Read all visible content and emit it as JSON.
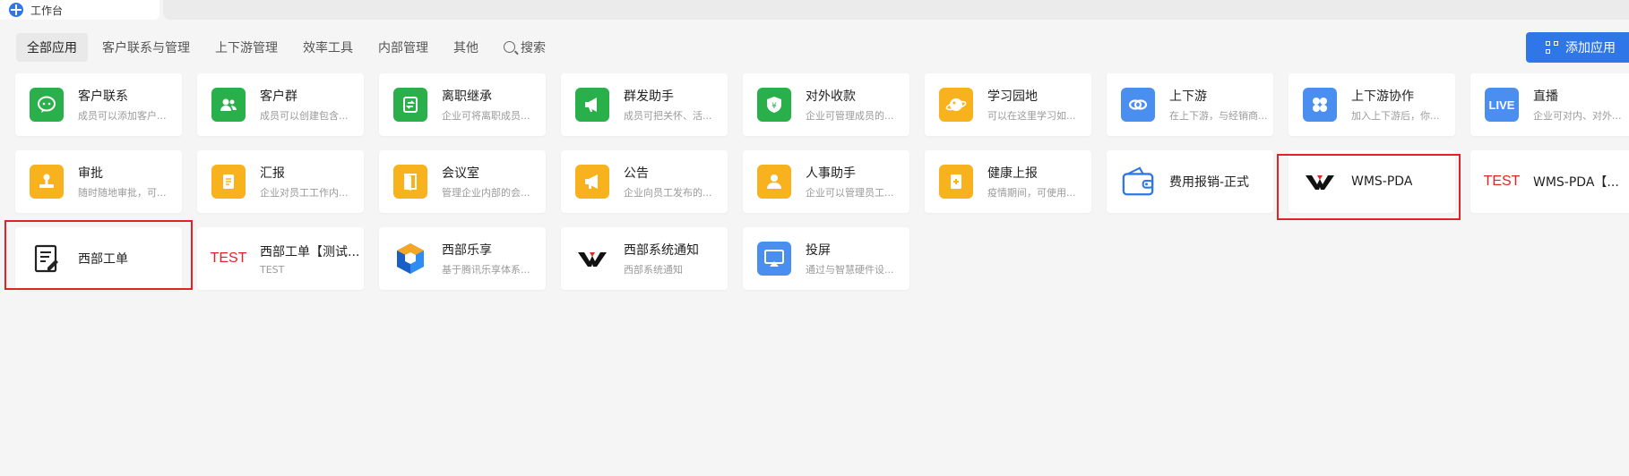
{
  "tab": {
    "title": "工作台"
  },
  "filters": [
    {
      "label": "全部应用"
    },
    {
      "label": "客户联系与管理"
    },
    {
      "label": "上下游管理"
    },
    {
      "label": "效率工具"
    },
    {
      "label": "内部管理"
    },
    {
      "label": "其他"
    },
    {
      "label": "搜索"
    }
  ],
  "add_button": {
    "label": "添加应用"
  },
  "apps": [
    {
      "name": "客户联系",
      "desc": "成员可以添加客户...",
      "icon": "chat-icon",
      "color": "#2ab04a"
    },
    {
      "name": "客户群",
      "desc": "成员可以创建包含...",
      "icon": "group-icon",
      "color": "#2ab04a"
    },
    {
      "name": "离职继承",
      "desc": "企业可将离职成员...",
      "icon": "transfer-icon",
      "color": "#2ab04a"
    },
    {
      "name": "群发助手",
      "desc": "成员可把关怀、活...",
      "icon": "megaphone-icon",
      "color": "#2ab04a"
    },
    {
      "name": "对外收款",
      "desc": "企业可管理成员的...",
      "icon": "payment-shield-icon",
      "color": "#2ab04a"
    },
    {
      "name": "学习园地",
      "desc": "可以在这里学习如...",
      "icon": "planet-icon",
      "color": "#f7b21e"
    },
    {
      "name": "上下游",
      "desc": "在上下游，与经销商...",
      "icon": "link-icon",
      "color": "#4a8ff0"
    },
    {
      "name": "上下游协作",
      "desc": "加入上下游后，你...",
      "icon": "grid-icon",
      "color": "#4a8ff0"
    },
    {
      "name": "直播",
      "desc": "企业可对内、对外...",
      "icon": "live-icon",
      "color": "#4a8ff0",
      "badge": "LIVE"
    },
    {
      "name": "审批",
      "desc": "随时随地审批，可...",
      "icon": "stamp-icon",
      "color": "#f7b21e"
    },
    {
      "name": "汇报",
      "desc": "企业对员工工作内...",
      "icon": "report-icon",
      "color": "#f7b21e"
    },
    {
      "name": "会议室",
      "desc": "管理企业内部的会...",
      "icon": "door-icon",
      "color": "#f7b21e"
    },
    {
      "name": "公告",
      "desc": "企业向员工发布的...",
      "icon": "announce-icon",
      "color": "#f7b21e"
    },
    {
      "name": "人事助手",
      "desc": "企业可以管理员工...",
      "icon": "person-icon",
      "color": "#f7b21e"
    },
    {
      "name": "健康上报",
      "desc": "疫情期间，可使用...",
      "icon": "health-icon",
      "color": "#f7b21e"
    },
    {
      "name": "费用报销-正式",
      "desc": "",
      "icon": "wallet-icon",
      "color": "#2f76e8"
    },
    {
      "name": "WMS-PDA",
      "desc": "",
      "icon": "wm-logo-icon",
      "color": "#222222"
    },
    {
      "name": "WMS-PDA【...",
      "desc": "",
      "icon": "test-text-icon",
      "color": "#e02424",
      "badge": "TEST"
    },
    {
      "name": "西部工单",
      "desc": "",
      "icon": "edit-doc-icon",
      "color": "#222222"
    },
    {
      "name": "西部工单【测试...",
      "desc": "TEST",
      "icon": "test-text-icon",
      "color": "#e02424",
      "badge": "TEST"
    },
    {
      "name": "西部乐享",
      "desc": "基于腾讯乐享体系...",
      "icon": "hexagon-icon",
      "color": "#2f76e8"
    },
    {
      "name": "西部系统通知",
      "desc": "西部系统通知",
      "icon": "wm-logo-icon",
      "color": "#222222"
    },
    {
      "name": "投屏",
      "desc": "通过与智慧硬件设...",
      "icon": "screencast-icon",
      "color": "#4a8ff0"
    }
  ],
  "colors": {
    "accent": "#2f76e8",
    "highlight": "#e02424",
    "green": "#2ab04a",
    "yellow": "#f7b21e",
    "blue": "#4a8ff0"
  }
}
